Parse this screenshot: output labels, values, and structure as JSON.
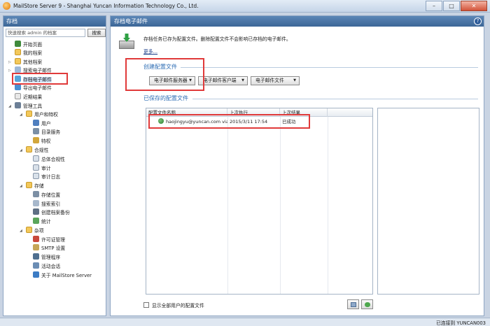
{
  "window": {
    "title": "MailStore Server 9 - Shanghai Yuncan Information Technology Co., Ltd.",
    "buttons": [
      "–",
      "□",
      "✕"
    ]
  },
  "sidebar": {
    "header": "存档",
    "search_placeholder": "快速搜索 admin 的档案",
    "search_button": "搜索",
    "items": [
      {
        "label": "开始页面",
        "icon": "home-icon"
      },
      {
        "label": "我的档案",
        "icon": "folder-icon"
      },
      {
        "label": "其他档案",
        "icon": "folder-icon"
      },
      {
        "label": "搜索电子邮件",
        "icon": "search-icon"
      },
      {
        "label": "存档电子邮件",
        "icon": "archive-icon"
      },
      {
        "label": "导出电子邮件",
        "icon": "export-icon"
      },
      {
        "label": "近期结果",
        "icon": "recent-icon"
      },
      {
        "label": "管理工具",
        "icon": "tools-icon"
      },
      {
        "label": "用户和特权",
        "icon": "folder-icon"
      },
      {
        "label": "用户",
        "icon": "user-icon"
      },
      {
        "label": "目录服务",
        "icon": "directory-icon"
      },
      {
        "label": "特权",
        "icon": "key-icon"
      },
      {
        "label": "合规性",
        "icon": "folder-icon"
      },
      {
        "label": "总体合规性",
        "icon": "document-icon"
      },
      {
        "label": "审计",
        "icon": "document-icon"
      },
      {
        "label": "审计日志",
        "icon": "document-icon"
      },
      {
        "label": "存储",
        "icon": "folder-icon"
      },
      {
        "label": "存储位置",
        "icon": "storage-icon"
      },
      {
        "label": "搜索索引",
        "icon": "index-icon"
      },
      {
        "label": "创建档案备份",
        "icon": "backup-icon"
      },
      {
        "label": "统计",
        "icon": "statistics-icon"
      },
      {
        "label": "杂项",
        "icon": "folder-icon"
      },
      {
        "label": "许可证管理",
        "icon": "license-icon"
      },
      {
        "label": "SMTP 设置",
        "icon": "smtp-icon"
      },
      {
        "label": "管理程序",
        "icon": "manager-icon"
      },
      {
        "label": "活动会话",
        "icon": "session-icon"
      },
      {
        "label": "关于 MailStore Server",
        "icon": "about-icon"
      }
    ]
  },
  "main": {
    "header": "存档电子邮件",
    "description": "存档任务已存为配置文件。删除配置文件不会影响已存档的电子邮件。",
    "more_link": "更多...",
    "create_section": {
      "title": "创建配置文件",
      "buttons": [
        "电子邮件服务器",
        "电子邮件客户端",
        "电子邮件文件"
      ]
    },
    "saved_section": {
      "title": "已保存的配置文件",
      "columns": [
        "配置文件名称",
        "上次执行",
        "上次结果"
      ],
      "rows": [
        {
          "name": "haojingyu@yuncan.com via ...",
          "last_run": "2015/3/11 17:54",
          "result": "已成功"
        }
      ]
    },
    "show_all_label": "显示全部用户的配置文件"
  },
  "status": {
    "connection": "已连接到 YUNCAN003"
  },
  "colors": {
    "header_blue": "#3c6697",
    "highlight_red": "#e03a3a",
    "link_blue": "#2e6db4"
  }
}
